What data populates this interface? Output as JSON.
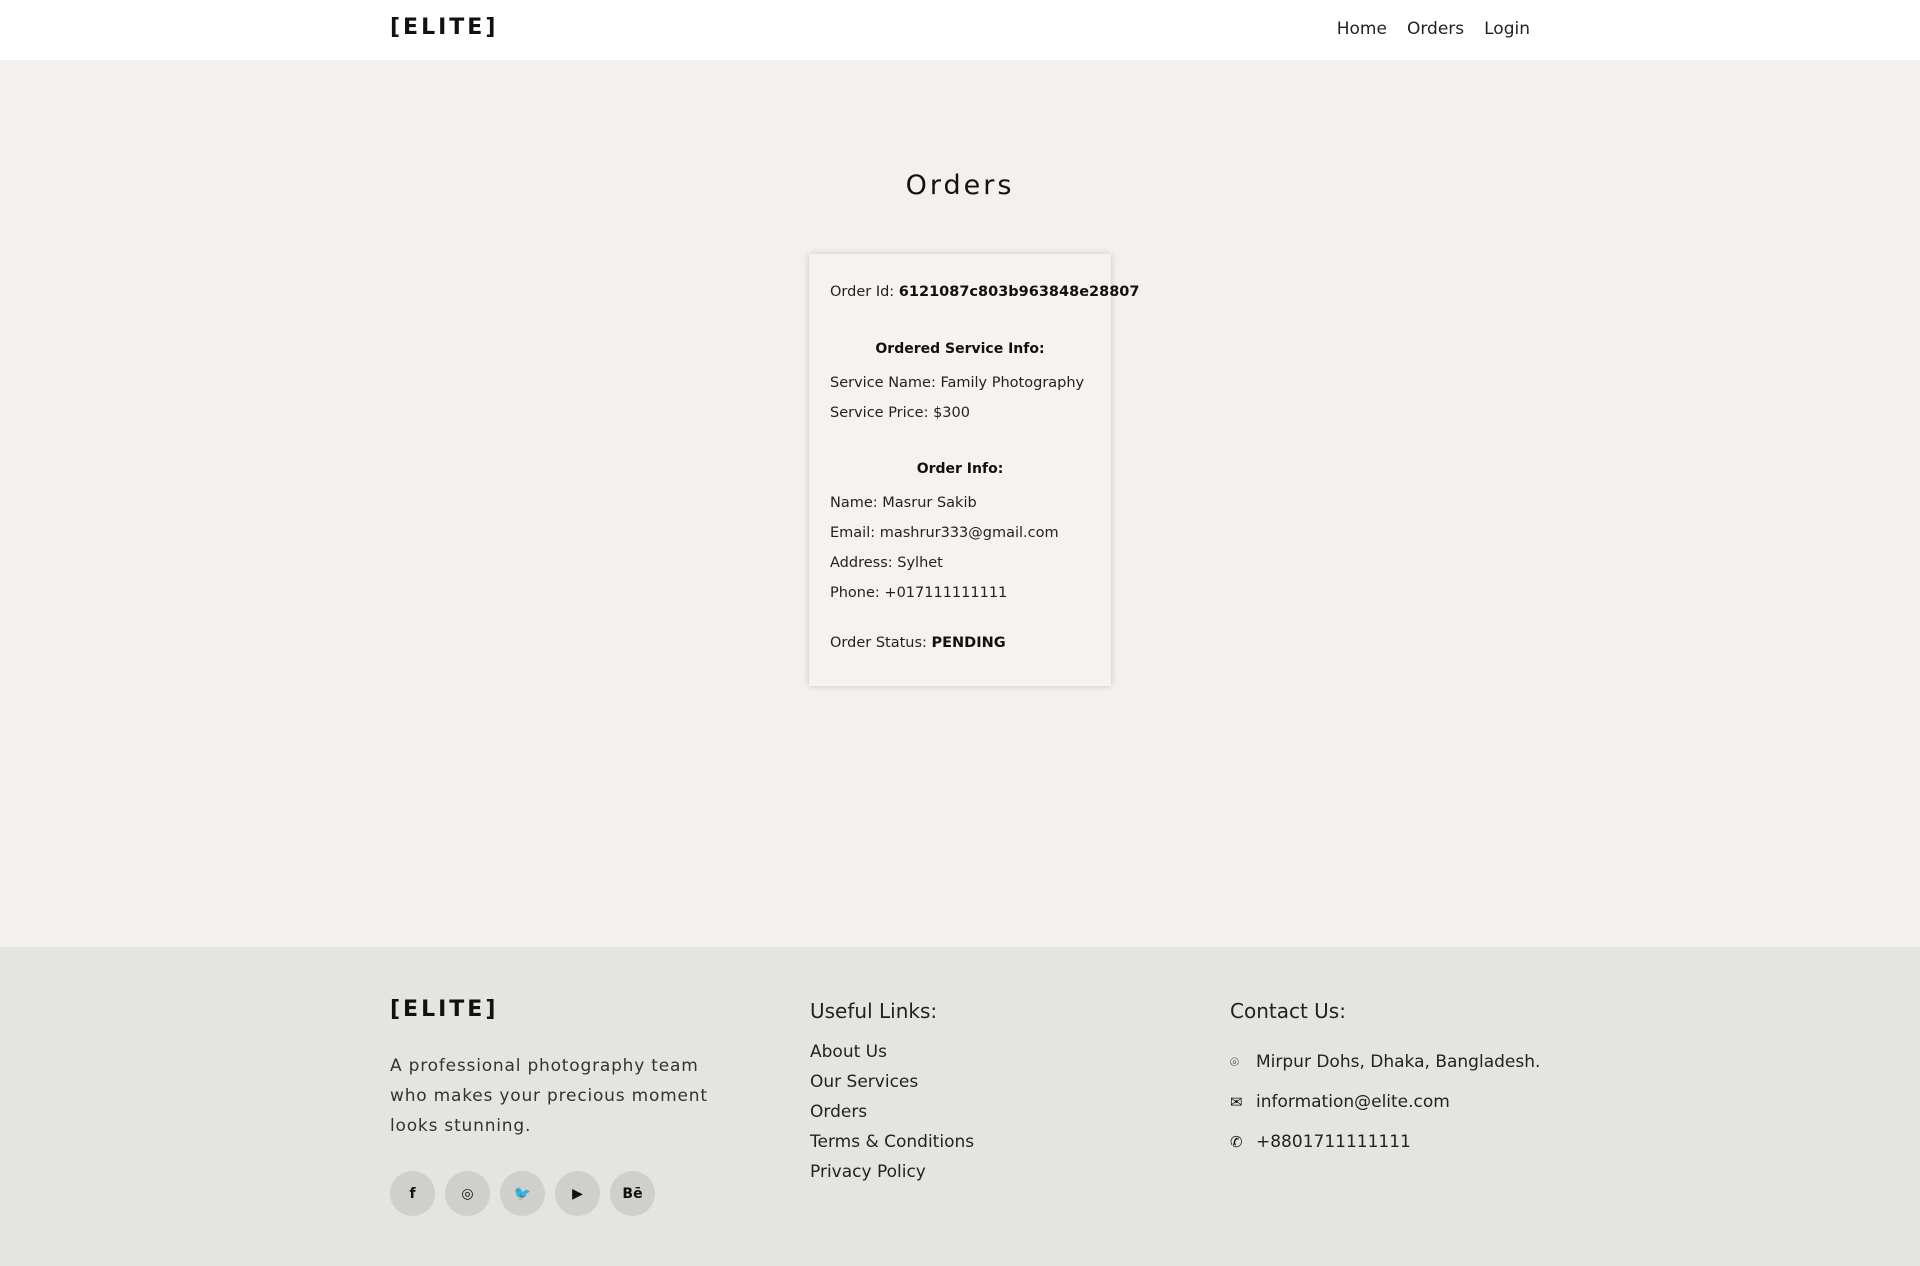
{
  "header": {
    "logo": "[ELITE]",
    "nav": [
      "Home",
      "Orders",
      "Login"
    ]
  },
  "page": {
    "title": "Orders"
  },
  "order": {
    "order_id_label": "Order Id:",
    "order_id": "6121087c803b963848e28807",
    "service_heading": "Ordered Service Info:",
    "service_name_label": "Service Name:",
    "service_name": "Family Photography",
    "service_price_label": "Service Price:",
    "service_price": "$300",
    "order_info_heading": "Order Info:",
    "name_label": "Name:",
    "name": "Masrur Sakib",
    "email_label": "Email:",
    "email": "mashrur333@gmail.com",
    "address_label": "Address:",
    "address": "Sylhet",
    "phone_label": "Phone:",
    "phone": "+017111111111",
    "status_label": "Order Status:",
    "status": "PENDING"
  },
  "footer": {
    "logo": "[ELITE]",
    "description": "A professional photography team who makes your precious moment looks stunning.",
    "socials": [
      {
        "icon": "facebook-icon",
        "glyph": "f"
      },
      {
        "icon": "instagram-icon",
        "glyph": "◎"
      },
      {
        "icon": "twitter-icon",
        "glyph": "🐦"
      },
      {
        "icon": "youtube-icon",
        "glyph": "▶"
      },
      {
        "icon": "behance-icon",
        "glyph": "Bē"
      }
    ],
    "links_title": "Useful Links:",
    "links": [
      "About Us",
      "Our Services",
      "Orders",
      "Terms & Conditions",
      "Privacy Policy"
    ],
    "contact_title": "Contact Us:",
    "contact": [
      {
        "icon": "location-icon",
        "glyph": "⌾",
        "text": "Mirpur Dohs, Dhaka, Bangladesh."
      },
      {
        "icon": "mail-icon",
        "glyph": "✉",
        "text": "information@elite.com"
      },
      {
        "icon": "phone-icon",
        "glyph": "✆",
        "text": "+8801711111111"
      }
    ]
  }
}
